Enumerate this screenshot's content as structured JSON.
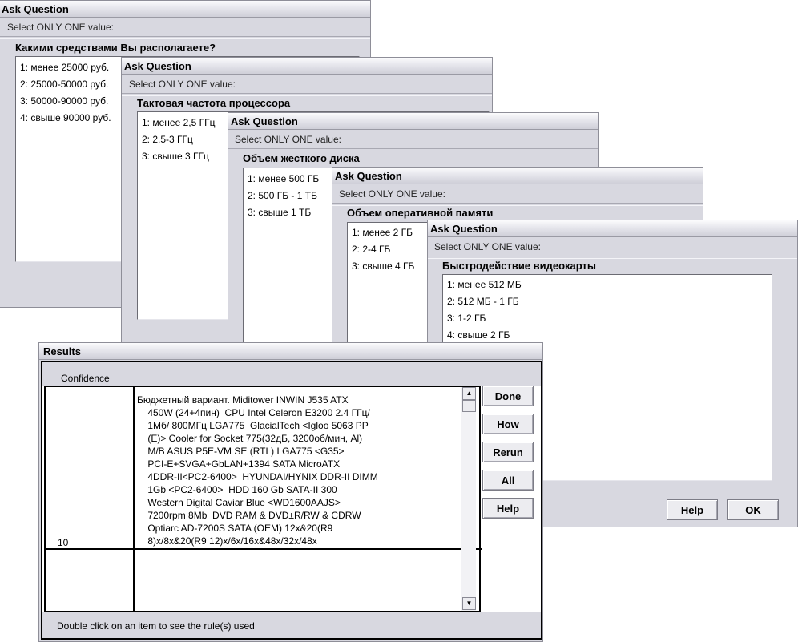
{
  "dialogs": [
    {
      "title": "Ask Question",
      "instruction": "Select ONLY ONE value:",
      "question": "Какими средствами Вы располагаете?",
      "options": [
        "1:  менее 25000 руб.",
        "2:  25000-50000 руб.",
        "3:  50000-90000 руб.",
        "4:  свыше 90000 руб."
      ]
    },
    {
      "title": "Ask Question",
      "instruction": "Select ONLY ONE value:",
      "question": "Тактовая частота процессора",
      "options": [
        "1:  менее 2,5 ГГц",
        "2:  2,5-3 ГГц",
        "3:  свыше 3 ГГц"
      ]
    },
    {
      "title": "Ask Question",
      "instruction": "Select ONLY ONE value:",
      "question": "Объем жесткого диска",
      "options": [
        "1:  менее 500 ГБ",
        "2:  500 ГБ - 1 ТБ",
        "3:  свыше 1 ТБ"
      ]
    },
    {
      "title": "Ask Question",
      "instruction": "Select ONLY ONE value:",
      "question": "Объем оперативной памяти",
      "options": [
        "1:  менее 2 ГБ",
        "2:  2-4 ГБ",
        "3:  свыше 4 ГБ"
      ]
    },
    {
      "title": "Ask Question",
      "instruction": "Select ONLY ONE value:",
      "question": "Быстродействие видеокарты",
      "options": [
        "1:  менее 512 МБ",
        "2:  512 МБ - 1 ГБ",
        "3:  1-2 ГБ",
        "4:  свыше 2 ГБ"
      ],
      "buttons": {
        "help": "Help",
        "ok": "OK"
      }
    }
  ],
  "results": {
    "title": "Results",
    "column_header": "Confidence",
    "rows": [
      {
        "confidence": "10",
        "text_lines": [
          "Бюджетный вариант. Miditower INWIN J535 ATX",
          "    450W (24+4пин)  CPU Intel Celeron E3200 2.4 ГГц/",
          "    1Мб/ 800МГц LGA775  GlacialTech <Igloo 5063 PP",
          "    (E)> Cooler for Socket 775(32дБ, 3200об/мин, Al)",
          "    M/B ASUS P5E-VM SE (RTL) LGA775 <G35>",
          "    PCI-E+SVGA+GbLAN+1394 SATA MicroATX",
          "    4DDR-II<PC2-6400>  HYUNDAI/HYNIX DDR-II DIMM",
          "    1Gb <PC2-6400>  HDD 160 Gb SATA-II 300",
          "    Western Digital Caviar Blue <WD1600AAJS>",
          "    7200rpm 8Mb  DVD RAM & DVD±R/RW & CDRW",
          "    Optiarc AD-7200S SATA (OEM) 12x&20(R9",
          "    8)x/8x&20(R9 12)x/6x/16x&48x/32x/48x"
        ]
      }
    ],
    "buttons": {
      "done": "Done",
      "how": "How",
      "rerun": "Rerun",
      "all": "All",
      "help": "Help"
    },
    "footer": "Double click on an item to see the rule(s) used"
  }
}
